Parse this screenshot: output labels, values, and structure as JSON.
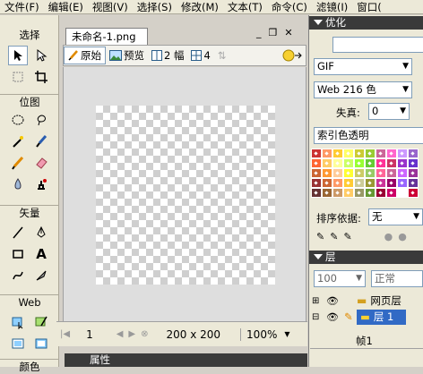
{
  "menu": [
    "文件(F)",
    "编辑(E)",
    "视图(V)",
    "选择(S)",
    "修改(M)",
    "文本(T)",
    "命令(C)",
    "滤镜(I)",
    "窗口("
  ],
  "tools": {
    "select_label": "选择",
    "bitmap_label": "位图",
    "vector_label": "矢量",
    "web_label": "Web",
    "color_label": "颜色"
  },
  "document": {
    "tab_title": "未命名-1.png",
    "win_buttons": [
      "_",
      "❐",
      "✕"
    ],
    "toolbar": {
      "original": "原始",
      "preview": "预览",
      "two_up": "2 幅",
      "four_up": "4"
    },
    "status": {
      "frame": "1",
      "size": "200 x 200",
      "zoom": "100%"
    },
    "properties_title": "属性"
  },
  "optimize": {
    "title": "优化",
    "format": "GIF",
    "palette": "Web 216 色",
    "loss_label": "失真:",
    "loss_value": "0",
    "transparency": "索引色透明",
    "sort_label": "排序依据:",
    "sort_value": "无",
    "swatch_colors": [
      "#cc3333",
      "#ff9966",
      "#ffcc33",
      "#ffff66",
      "#cccc33",
      "#99cc33",
      "#cc6699",
      "#ff66cc",
      "#cc99ff",
      "#9966cc",
      "#ff6633",
      "#ffcc66",
      "#ffff99",
      "#ccff66",
      "#99ff33",
      "#66cc33",
      "#ff3399",
      "#cc3366",
      "#9933cc",
      "#6633cc",
      "#cc6633",
      "#ff9933",
      "#ffcc99",
      "#ffff33",
      "#cccc66",
      "#99cc66",
      "#ff6699",
      "#cc6699",
      "#cc66ff",
      "#993399",
      "#993333",
      "#cc6633",
      "#ff9966",
      "#ffcc33",
      "#cccc99",
      "#999933",
      "#cc3399",
      "#990066",
      "#9966ff",
      "#663399",
      "#663333",
      "#996633",
      "#cc9966",
      "#ffcc66",
      "#999966",
      "#669933",
      "#990033",
      "#cc0066",
      "#ffffff",
      "#cc0033"
    ]
  },
  "layers": {
    "title": "层",
    "opacity": "100",
    "blend": "正常",
    "items": [
      "网页层",
      "层 1"
    ],
    "frame_label": "帧1"
  }
}
